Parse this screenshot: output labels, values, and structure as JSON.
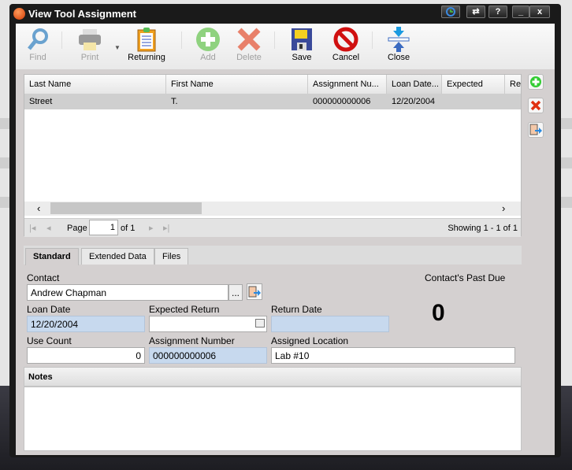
{
  "window": {
    "title": "View Tool Assignment",
    "buttons": [
      "?",
      "x"
    ]
  },
  "toolbar": {
    "find": "Find",
    "print": "Print",
    "returning": "Returning",
    "add": "Add",
    "delete": "Delete",
    "save": "Save",
    "cancel": "Cancel",
    "close": "Close"
  },
  "grid": {
    "columns": [
      "Last Name",
      "First Name",
      "Assignment Nu...",
      "Loan Date...",
      "Expected",
      "Ret"
    ],
    "rows": [
      {
        "last_name": "Street",
        "first_name": "T.",
        "assignment_number": "000000000006",
        "loan_date": "12/20/2004",
        "expected": "",
        "ret": ""
      }
    ],
    "pager": {
      "page_label": "Page",
      "page": "1",
      "of": "of 1",
      "showing": "Showing 1 - 1 of 1"
    }
  },
  "tabs": [
    "Standard",
    "Extended Data",
    "Files"
  ],
  "form": {
    "contact_label": "Contact",
    "contact_value": "Andrew Chapman",
    "browse": "...",
    "past_due_label": "Contact's Past Due",
    "past_due_value": "0",
    "loan_date_label": "Loan Date",
    "loan_date_value": "12/20/2004",
    "expected_return_label": "Expected Return",
    "expected_return_value": "",
    "return_date_label": "Return Date",
    "return_date_value": "",
    "use_count_label": "Use Count",
    "use_count_value": "0",
    "assignment_number_label": "Assignment Number",
    "assignment_number_value": "000000000006",
    "assigned_location_label": "Assigned Location",
    "assigned_location_value": "Lab #10",
    "notes_label": "Notes",
    "notes_value": ""
  }
}
